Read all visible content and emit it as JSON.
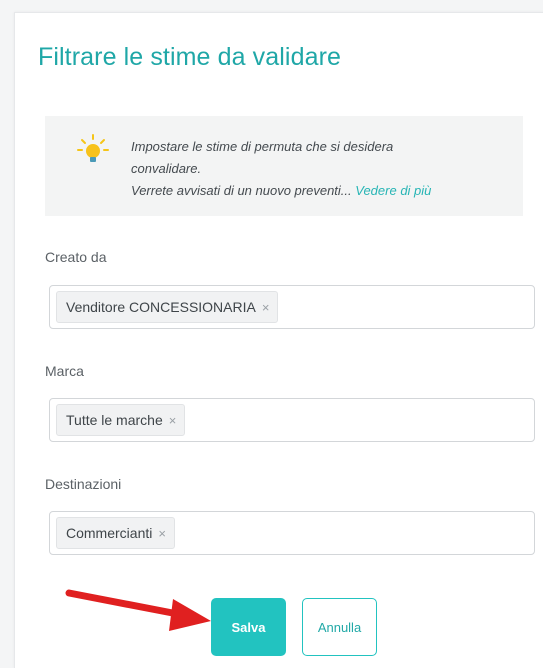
{
  "dialog": {
    "title": "Filtrare le stime da validare"
  },
  "info": {
    "icon": "lightbulb-icon",
    "line1": "Impostare le stime di permuta che si desidera",
    "line2": "convalidare.",
    "line3": "Verrete avvisati di un nuovo preventi...",
    "link_label": "Vedere di più"
  },
  "filters": {
    "created_by": {
      "label": "Creato da",
      "tag": "Venditore CONCESSIONARIA",
      "remove": "×"
    },
    "brand": {
      "label": "Marca",
      "tag": "Tutte le marche",
      "remove": "×"
    },
    "destinations": {
      "label": "Destinazioni",
      "tag": "Commercianti",
      "remove": "×"
    }
  },
  "actions": {
    "save_label": "Salva",
    "cancel_label": "Annulla"
  },
  "colors": {
    "accent": "#22c3c0",
    "title": "#1fa7a7",
    "annotation_arrow": "#e02020"
  }
}
